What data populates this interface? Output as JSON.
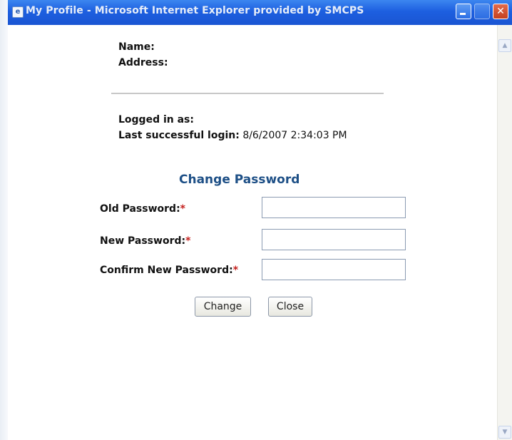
{
  "window": {
    "title": "My Profile - Microsoft Internet Explorer provided by SMCPS",
    "app_icon_glyph": "e"
  },
  "profile": {
    "name_label": "Name:",
    "address_label": "Address:",
    "logged_in_label": "Logged in as:",
    "last_login_label": "Last successful login:",
    "last_login_value": "8/6/2007 2:34:03 PM"
  },
  "change_password": {
    "title": "Change Password",
    "required_marker": "*",
    "old_label": "Old Password:",
    "new_label": "New Password:",
    "confirm_label": "Confirm New Password:",
    "old_value": "",
    "new_value": "",
    "confirm_value": ""
  },
  "buttons": {
    "change": "Change",
    "close": "Close"
  },
  "colors": {
    "titlebar": "#1d5fe0",
    "section_title": "#1d4f86",
    "required": "#c4201d"
  }
}
